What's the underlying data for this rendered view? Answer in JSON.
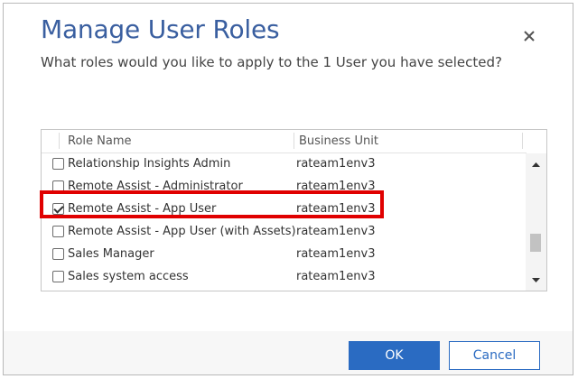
{
  "dialog": {
    "title": "Manage User Roles",
    "subtitle": "What roles would you like to apply to the 1 User you have selected?",
    "close_icon": "close-icon"
  },
  "table": {
    "columns": [
      "Role Name",
      "Business Unit"
    ],
    "rows": [
      {
        "role": "Relationship Insights Admin",
        "business_unit": "rateam1env3",
        "checked": false
      },
      {
        "role": "Remote Assist - Administrator",
        "business_unit": "rateam1env3",
        "checked": false
      },
      {
        "role": "Remote Assist - App User",
        "business_unit": "rateam1env3",
        "checked": true
      },
      {
        "role": "Remote Assist - App User (with Assets)",
        "business_unit": "rateam1env3",
        "checked": false
      },
      {
        "role": "Sales Manager",
        "business_unit": "rateam1env3",
        "checked": false
      },
      {
        "role": "Sales system access",
        "business_unit": "rateam1env3",
        "checked": false
      }
    ],
    "highlighted_row": 2,
    "highlight_color": "#e00000"
  },
  "buttons": {
    "ok_label": "OK",
    "cancel_label": "Cancel"
  },
  "colors": {
    "title": "#3a5fa0",
    "primary": "#2a6bc2"
  }
}
